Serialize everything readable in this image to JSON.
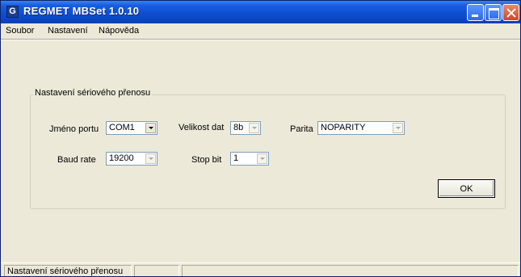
{
  "window": {
    "title": "REGMET MBSet 1.0.10",
    "app_icon_letter": "G"
  },
  "menu": {
    "items": [
      "Soubor",
      "Nastavení",
      "Nápověda"
    ]
  },
  "serial_group": {
    "legend": "Nastavení sériového přenosu",
    "port_label": "Jméno portu",
    "port_value": "COM1",
    "datasize_label": "Velikost dat",
    "datasize_value": "8b",
    "parity_label": "Parita",
    "parity_value": "NOPARITY",
    "baud_label": "Baud rate",
    "baud_value": "19200",
    "stopbit_label": "Stop bit",
    "stopbit_value": "1",
    "ok_label": "OK"
  },
  "statusbar": {
    "panes": [
      "Nastavení sériového přenosu",
      "",
      ""
    ]
  },
  "colors": {
    "titlebar": "#0d4fd3",
    "window_bg": "#ece9d8",
    "close_button": "#d3461f"
  }
}
